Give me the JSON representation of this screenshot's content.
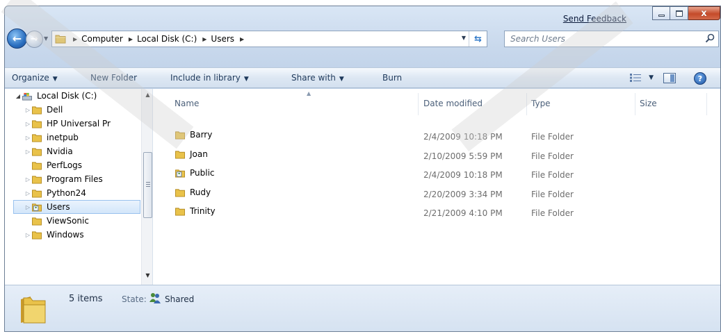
{
  "window": {
    "feedback_link": "Send Feedback",
    "close_glyph": "x"
  },
  "navigation": {
    "breadcrumbs": [
      "Computer",
      "Local Disk (C:)",
      "Users"
    ],
    "search_placeholder": "Search Users"
  },
  "toolbar": {
    "organize": "Organize",
    "new_folder": "New Folder",
    "include_in_library": "Include in library",
    "share_with": "Share with",
    "burn": "Burn",
    "help_glyph": "?"
  },
  "tree": {
    "items": [
      {
        "label": "Local Disk (C:)",
        "icon": "drive-icon",
        "expanded": true
      },
      {
        "label": "Dell",
        "icon": "folder-icon"
      },
      {
        "label": "HP Universal Pr",
        "icon": "folder-icon"
      },
      {
        "label": "inetpub",
        "icon": "folder-icon"
      },
      {
        "label": "Nvidia",
        "icon": "folder-icon"
      },
      {
        "label": "PerfLogs",
        "icon": "folder-icon"
      },
      {
        "label": "Program Files",
        "icon": "folder-icon"
      },
      {
        "label": "Python24",
        "icon": "folder-icon"
      },
      {
        "label": "Users",
        "icon": "user-folder-icon",
        "selected": true
      },
      {
        "label": "ViewSonic",
        "icon": "folder-icon"
      },
      {
        "label": "Windows",
        "icon": "folder-icon"
      }
    ]
  },
  "files": {
    "columns": [
      "Name",
      "Date modified",
      "Type",
      "Size"
    ],
    "rows": [
      {
        "name": "Barry",
        "date": "2/4/2009 10:18 PM",
        "type": "File Folder",
        "size": "",
        "icon": "folder-icon"
      },
      {
        "name": "Joan",
        "date": "2/10/2009 5:59 PM",
        "type": "File Folder",
        "size": "",
        "icon": "folder-icon"
      },
      {
        "name": "Public",
        "date": "2/4/2009 10:18 PM",
        "type": "File Folder",
        "size": "",
        "icon": "user-folder-icon"
      },
      {
        "name": "Rudy",
        "date": "2/20/2009 3:34 PM",
        "type": "File Folder",
        "size": "",
        "icon": "folder-icon"
      },
      {
        "name": "Trinity",
        "date": "2/21/2009 4:10 PM",
        "type": "File Folder",
        "size": "",
        "icon": "folder-icon"
      }
    ]
  },
  "details": {
    "count": "5 items",
    "state_label": "State:",
    "state_value": "Shared"
  },
  "colors": {
    "folder_yellow": "#e9c24a",
    "selection_blue": "#d3e6fa",
    "close_red": "#c44b2a"
  }
}
